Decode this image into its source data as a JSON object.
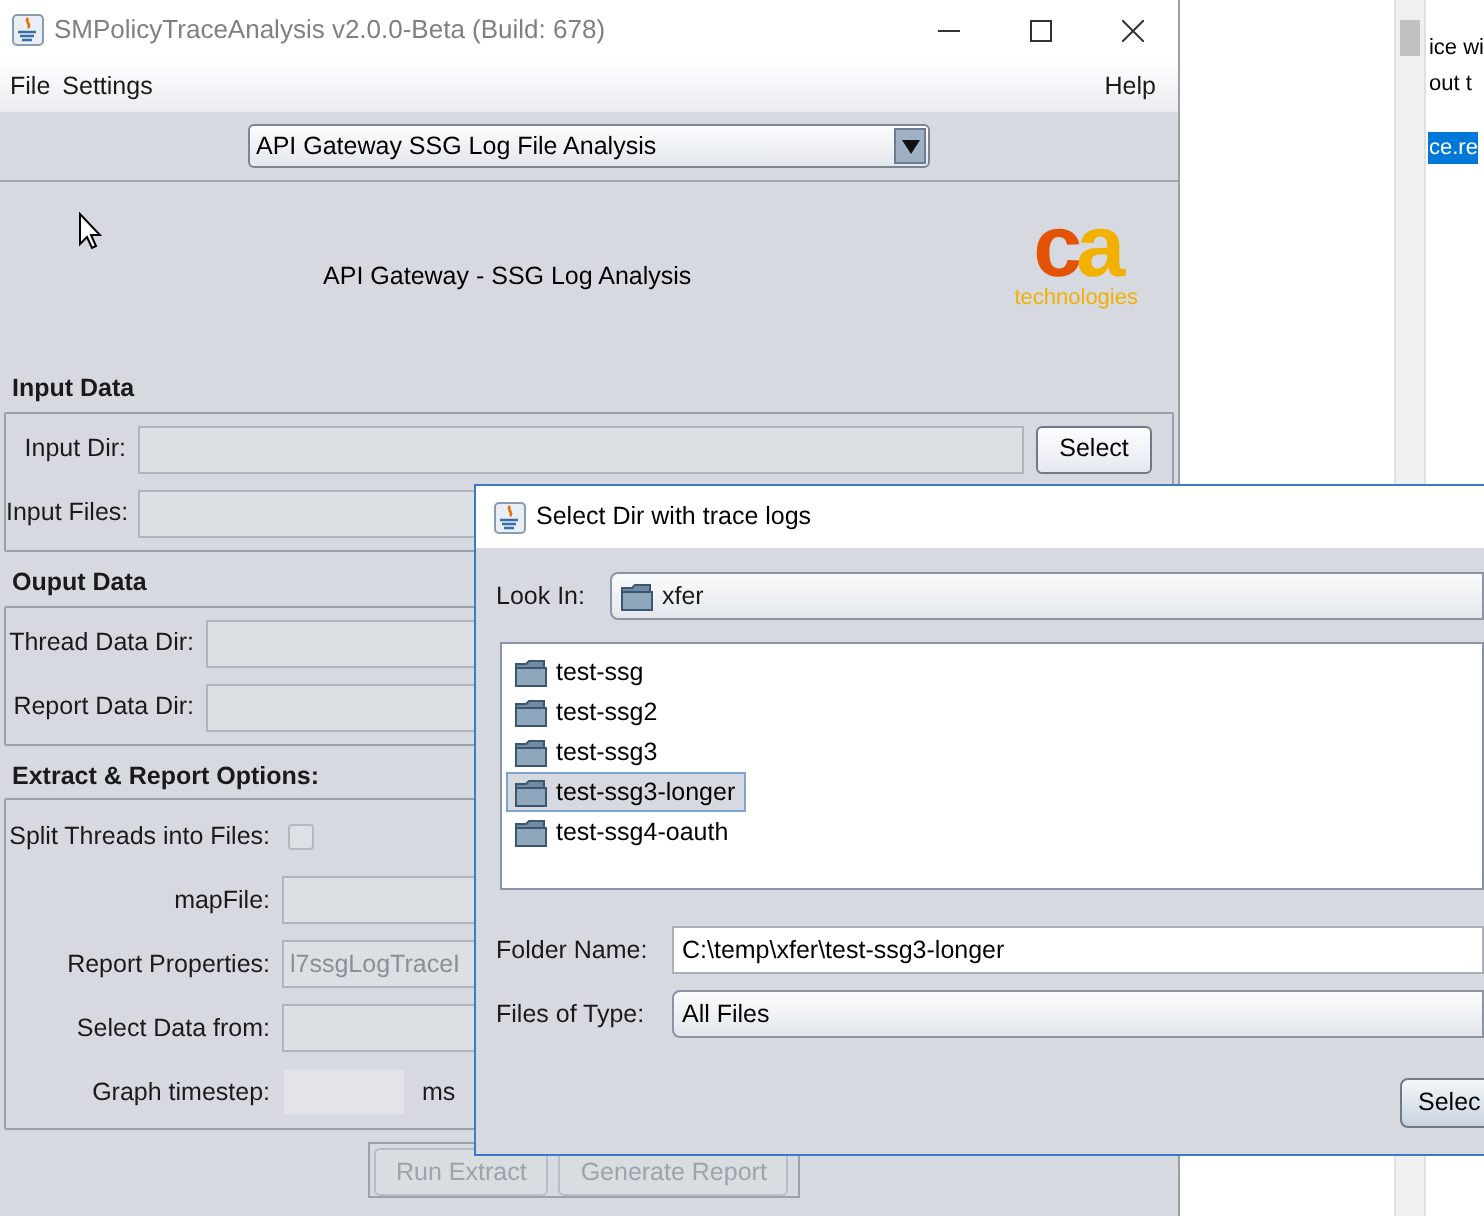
{
  "background_window": {
    "lines": [
      {
        "text": "ice wi",
        "selected": false
      },
      {
        "text": "out t",
        "selected": false
      },
      {
        "text": "ce.re",
        "selected": true
      }
    ]
  },
  "main_window": {
    "title": "SMPolicyTraceAnalysis v2.0.0-Beta (Build: 678)",
    "menu": [
      {
        "label": "File"
      },
      {
        "label": "Settings"
      },
      {
        "label": "Help"
      }
    ],
    "analysis_type": "API Gateway SSG Log File Analysis",
    "header": "API Gateway - SSG Log Analysis",
    "logo": {
      "mark": "ca",
      "tagline": "technologies"
    },
    "sections": [
      {
        "title": "Input Data",
        "rows": [
          {
            "kind": "field",
            "label": "Input Dir:",
            "button": "Select"
          },
          {
            "kind": "field",
            "label": "Input Files:"
          }
        ]
      },
      {
        "title": "Ouput Data",
        "rows": [
          {
            "kind": "field",
            "label": "Thread Data Dir:"
          },
          {
            "kind": "field",
            "label": "Report Data Dir:"
          }
        ]
      },
      {
        "title": "Extract & Report Options:",
        "rows": [
          {
            "kind": "checkbox",
            "label": "Split Threads into Files:",
            "checked": false
          },
          {
            "kind": "field",
            "label": "mapFile:"
          },
          {
            "kind": "field",
            "label": "Report Properties:",
            "value": "l7ssgLogTraceI"
          },
          {
            "kind": "field",
            "label": "Select Data from:"
          },
          {
            "kind": "unit",
            "label": "Graph timestep:",
            "unit": "ms"
          }
        ]
      }
    ],
    "buttons": [
      {
        "label": "Run Extract",
        "disabled": true
      },
      {
        "label": "Generate Report",
        "disabled": true
      }
    ]
  },
  "dialog": {
    "title": "Select Dir with trace logs",
    "look_in_label": "Look In:",
    "look_in": "xfer",
    "folders": [
      {
        "name": "test-ssg",
        "selected": false
      },
      {
        "name": "test-ssg2",
        "selected": false
      },
      {
        "name": "test-ssg3",
        "selected": false
      },
      {
        "name": "test-ssg3-longer",
        "selected": true
      },
      {
        "name": "test-ssg4-oauth",
        "selected": false
      }
    ],
    "folder_name_label": "Folder Name:",
    "folder_name": "C:\\temp\\xfer\\test-ssg3-longer",
    "files_of_type_label": "Files of Type:",
    "files_of_type": "All Files",
    "button": "Selec"
  }
}
